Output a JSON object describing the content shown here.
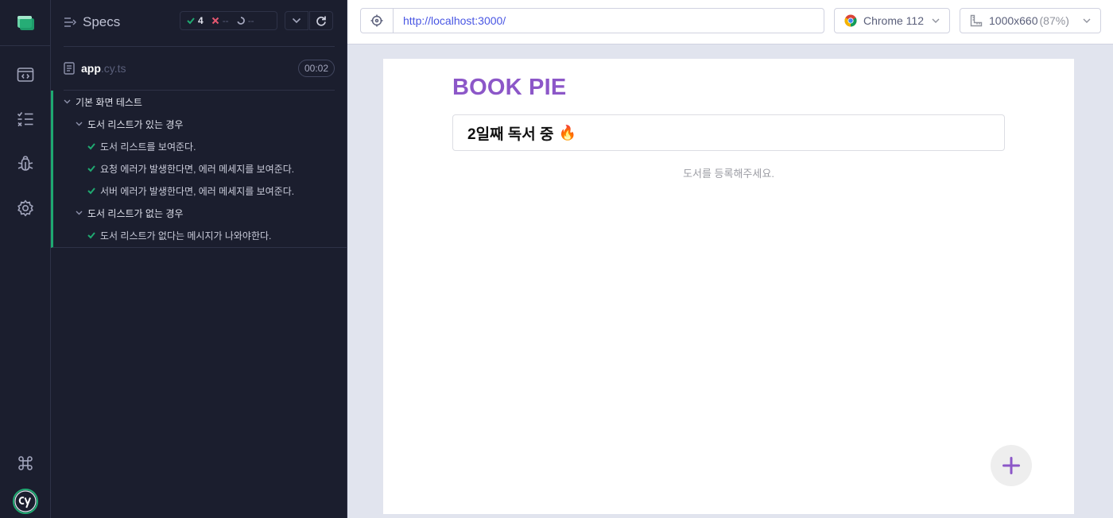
{
  "sidebar": {
    "specs_label": "Specs"
  },
  "stats": {
    "passed": "4",
    "failed": "--",
    "pending": "--"
  },
  "spec_file": {
    "name": "app",
    "extension": ".cy.ts",
    "duration": "00:02"
  },
  "tree": {
    "root": "기본 화면 테스트",
    "suite1": {
      "title": "도서 리스트가 있는 경우",
      "tests": [
        "도서 리스트를 보여준다.",
        "요청 에러가 발생한다면, 에러 메세지를 보여준다.",
        "서버 에러가 발생한다면, 에러 메세지를 보여준다."
      ]
    },
    "suite2": {
      "title": "도서 리스트가 없는 경우",
      "tests": [
        "도서 리스트가 없다는 메시지가 나와야한다."
      ]
    }
  },
  "topbar": {
    "url": "http://localhost:3000/",
    "browser": "Chrome 112",
    "viewport": "1000x660",
    "zoom": "(87%)"
  },
  "app": {
    "title": "BOOK PIE",
    "status": "2일째 독서 중",
    "status_emoji": "🔥",
    "empty_message": "도서를 등록해주세요."
  },
  "colors": {
    "pass": "#1fa971",
    "fail": "#e45770",
    "brand": "#8c57c8",
    "url": "#4956e3"
  }
}
